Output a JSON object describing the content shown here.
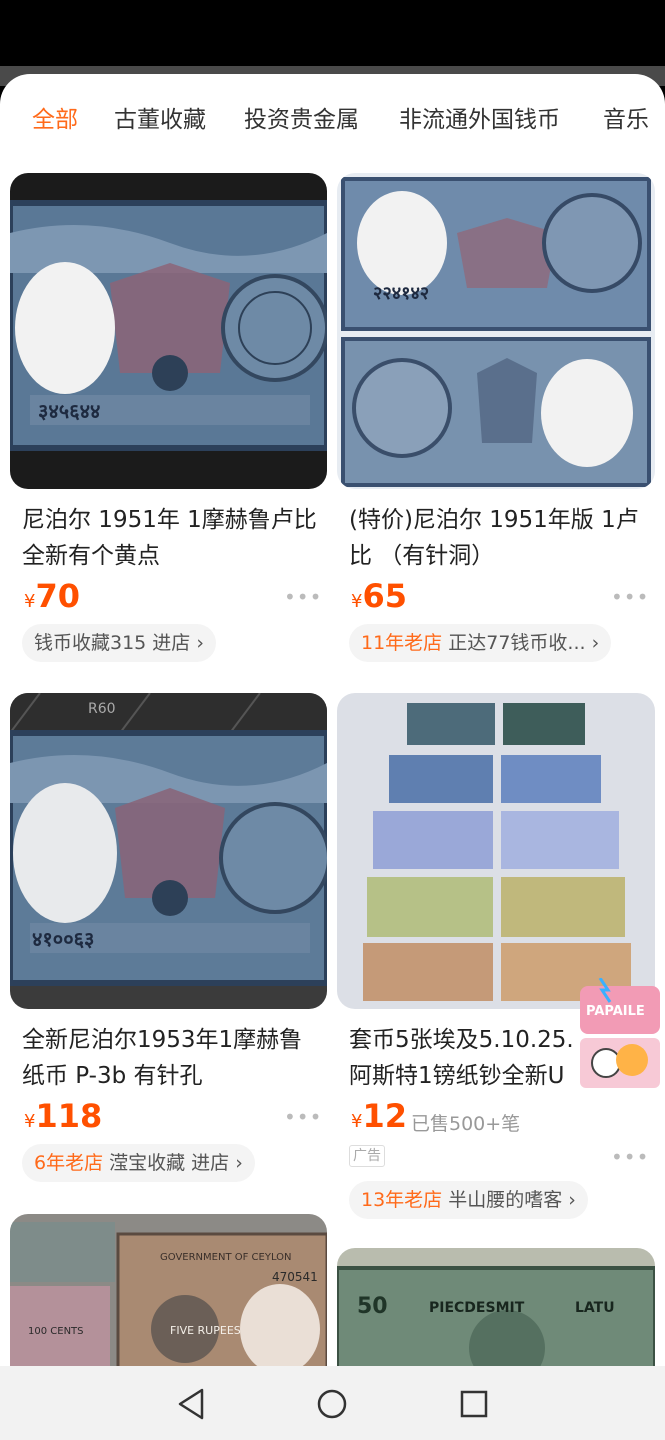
{
  "tabs": [
    "全部",
    "古董收藏",
    "投资贵金属",
    "非流通外国钱币",
    "音乐"
  ],
  "active_tab": 0,
  "products": [
    {
      "title": "尼泊尔 1951年 1摩赫鲁卢比 全新有个黄点",
      "price": "70",
      "currency": "¥",
      "sold": "",
      "shop_age": "",
      "shop": "钱币收藏315 进店",
      "ad": ""
    },
    {
      "title": "(特价)尼泊尔 1951年版 1卢比 （有针洞）",
      "price": "65",
      "currency": "¥",
      "sold": "",
      "shop_age": "11年老店",
      "shop": "正达77钱币收...",
      "ad": ""
    },
    {
      "title": "全新尼泊尔1953年1摩赫鲁纸币 P-3b 有针孔",
      "price": "118",
      "currency": "¥",
      "sold": "",
      "shop_age": "6年老店",
      "shop": "滢宝收藏 进店",
      "ad": ""
    },
    {
      "title": "套币5张埃及5.10.25.阿斯特1镑纸钞全新U",
      "price": "12",
      "currency": "¥",
      "sold": "已售500+笔",
      "shop_age": "13年老店",
      "shop": "半山腰的嗜客",
      "ad": "广告"
    }
  ],
  "banknote_text": {
    "serial_1": "३४५६४४",
    "serial_2": "२२४१४२",
    "serial_3": "४१००६३",
    "label_wide": "R60",
    "ceylon": "GOVERNMENT OF CEYLON",
    "ceylon_serial": "470541",
    "ceylon_value": "FIVE RUPEES",
    "ceylon_cents": "100 CENTS",
    "latvia_1": "PIECDESMIT",
    "latvia_2": "LATU",
    "latvia_num": "50"
  },
  "floating_badge": "PAPAILE",
  "colors": {
    "accent": "#ff6a1a",
    "price": "#ff5000"
  },
  "icons": [
    "back-icon",
    "home-icon",
    "recents-icon",
    "chevron-right-icon",
    "more-dots-icon"
  ]
}
